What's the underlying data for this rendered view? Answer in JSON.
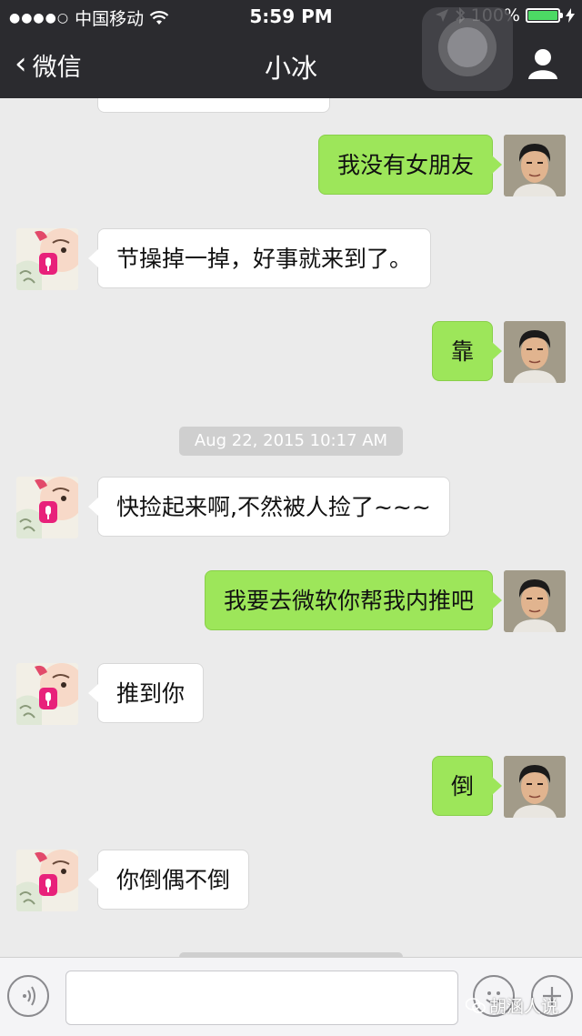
{
  "status_bar": {
    "carrier": "中国移动",
    "time": "5:59 PM",
    "battery": "100%",
    "colors": {
      "battery_fill": "#4cd964"
    }
  },
  "nav": {
    "back_label": "微信",
    "title": "小冰"
  },
  "messages": [
    {
      "from": "me",
      "text": "我没有女朋友"
    },
    {
      "from": "other",
      "text": "节操掉一掉，好事就来到了。"
    },
    {
      "from": "me",
      "text": "靠"
    },
    {
      "from": "other",
      "text": "快捡起来啊,不然被人捡了~~~"
    },
    {
      "from": "me",
      "text": "我要去微软你帮我内推吧"
    },
    {
      "from": "other",
      "text": "推到你"
    },
    {
      "from": "me",
      "text": "倒"
    },
    {
      "from": "other",
      "text": "你倒偶不倒"
    }
  ],
  "timestamp": "Aug 22, 2015 10:17 AM",
  "input_bar": {
    "voice_icon": "voice-icon",
    "emoji_icon": "emoji-icon",
    "plus_icon": "plus-icon"
  },
  "watermark": "胡涵人说",
  "colors": {
    "outgoing_bubble": "#9de65a",
    "incoming_bubble": "#ffffff",
    "nav_background": "#2b2b2f",
    "chat_background": "#ebebeb"
  }
}
